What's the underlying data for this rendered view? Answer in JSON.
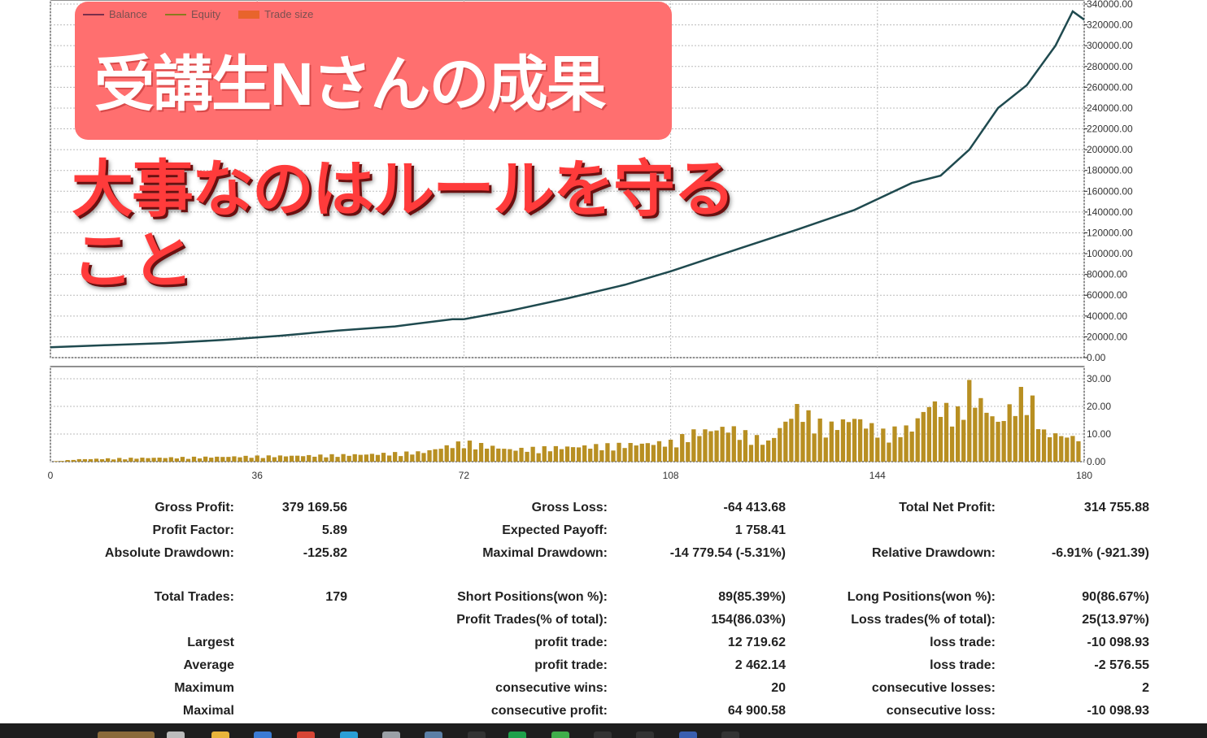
{
  "legend": [
    {
      "label": "Balance",
      "color": "#7a2e4a"
    },
    {
      "label": "Equity",
      "color": "#8a7a1e"
    },
    {
      "label": "Trade size",
      "color": "#e8642c"
    }
  ],
  "headline": "受講生Nさんの成果",
  "overlay_text": [
    "大事なのはルールを守る",
    "こと"
  ],
  "chart_data": [
    {
      "type": "line",
      "series": [
        {
          "name": "Balance",
          "color": "#1f4a4f"
        }
      ],
      "x": [
        0,
        10,
        20,
        30,
        40,
        50,
        60,
        70,
        72,
        80,
        90,
        100,
        108,
        120,
        130,
        140,
        150,
        155,
        160,
        165,
        170,
        175,
        178,
        180
      ],
      "y": [
        10000,
        12000,
        14000,
        17000,
        21000,
        26000,
        30000,
        37000,
        37000,
        45000,
        57000,
        70000,
        83000,
        105000,
        123000,
        142000,
        168000,
        175000,
        200000,
        240000,
        262000,
        300000,
        333000,
        325000
      ],
      "xlim": [
        0,
        180
      ],
      "ylim": [
        0,
        340000
      ],
      "x_ticks": [
        "0",
        "36",
        "72",
        "108",
        "144",
        "180"
      ],
      "y_ticks": [
        "0.00",
        "20000.00",
        "40000.00",
        "60000.00",
        "80000.00",
        "100000.00",
        "120000.00",
        "140000.00",
        "160000.00",
        "180000.00",
        "200000.00",
        "220000.00",
        "240000.00",
        "260000.00",
        "280000.00",
        "300000.00",
        "320000.00",
        "340000.00"
      ],
      "grid": true
    },
    {
      "type": "bar",
      "series": [
        {
          "name": "Trade size",
          "color": "#b88f22"
        }
      ],
      "x": [
        5,
        15,
        25,
        35,
        45,
        55,
        65,
        72,
        80,
        90,
        100,
        108,
        112,
        118,
        125,
        130,
        135,
        140,
        145,
        150,
        153,
        158,
        160,
        165,
        170,
        173,
        178
      ],
      "values": [
        1,
        1.5,
        1.8,
        2.2,
        2.5,
        3,
        4,
        8,
        5,
        6,
        7,
        8,
        12,
        14,
        8,
        22,
        14,
        18,
        12,
        14,
        24,
        20,
        30,
        16,
        30,
        12,
        10
      ],
      "xlim": [
        0,
        180
      ],
      "ylim": [
        0,
        30
      ],
      "y_ticks": [
        "0.00",
        "10.00",
        "20.00",
        "30.00"
      ]
    }
  ],
  "stats": {
    "rows": [
      [
        "Gross Profit:",
        "379 169.56",
        "Gross Loss:",
        "-64 413.68",
        "Total Net Profit:",
        "314 755.88"
      ],
      [
        "Profit Factor:",
        "5.89",
        "Expected Payoff:",
        "1 758.41",
        "",
        ""
      ],
      [
        "Absolute Drawdown:",
        "-125.82",
        "Maximal Drawdown:",
        "-14 779.54 (-5.31%)",
        "Relative Drawdown:",
        "-6.91% (-921.39)"
      ],
      [
        "",
        "",
        "",
        "",
        "",
        ""
      ],
      [
        "Total Trades:",
        "179",
        "Short Positions(won %):",
        "89(85.39%)",
        "Long Positions(won %):",
        "90(86.67%)"
      ],
      [
        "",
        "",
        "Profit Trades(% of total):",
        "154(86.03%)",
        "Loss trades(% of total):",
        "25(13.97%)"
      ],
      [
        "Largest",
        "",
        "profit trade:",
        "12 719.62",
        "loss trade:",
        "-10 098.93"
      ],
      [
        "Average",
        "",
        "profit trade:",
        "2 462.14",
        "loss trade:",
        "-2 576.55"
      ],
      [
        "Maximum",
        "",
        "consecutive wins:",
        "20",
        "consecutive losses:",
        "2"
      ],
      [
        "Maximal",
        "",
        "consecutive profit:",
        "64 900.58",
        "consecutive loss:",
        "-10 098.93"
      ]
    ]
  }
}
